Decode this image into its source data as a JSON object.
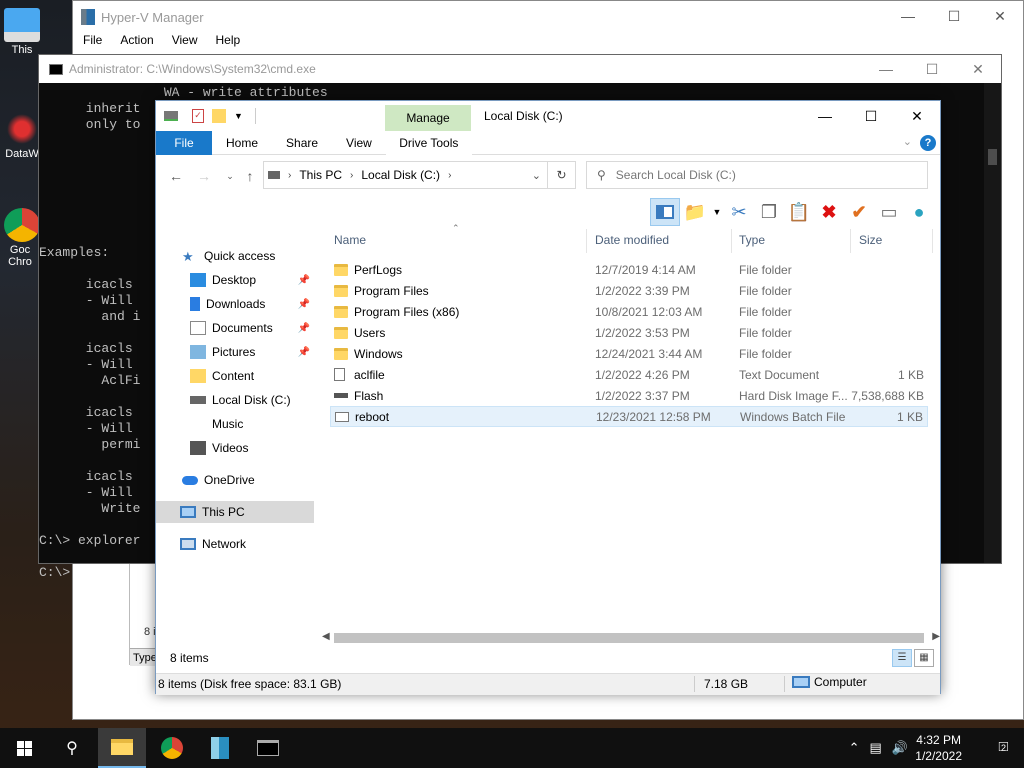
{
  "desktop": {
    "icons": [
      {
        "label": "This"
      },
      {
        "label": "DataW"
      },
      {
        "label": "Goc Chro"
      }
    ]
  },
  "hyperv": {
    "title": "Hyper-V Manager",
    "menu": [
      "File",
      "Action",
      "View",
      "Help"
    ],
    "lower_count": "8 i",
    "lower_type": "Type"
  },
  "cmd": {
    "title": "Administrator: C:\\Windows\\System32\\cmd.exe",
    "lines": [
      "                WA - write attributes",
      "      inherit",
      "      only to",
      "",
      "",
      "",
      "",
      "",
      "",
      "",
      "Examples:",
      "",
      "      icacls",
      "      - Will",
      "        and i",
      "",
      "      icacls",
      "      - Will",
      "        AclFi",
      "",
      "      icacls",
      "      - Will",
      "        permi",
      "",
      "      icacls",
      "      - Will",
      "        Write",
      "",
      "C:\\> explorer",
      "",
      "C:\\>"
    ]
  },
  "explorer": {
    "title": "Local Disk (C:)",
    "manage_tab": "Manage",
    "ribbon_tabs": [
      "File",
      "Home",
      "Share",
      "View"
    ],
    "drive_tools": "Drive Tools",
    "address": {
      "root": "This PC",
      "current": "Local Disk (C:)"
    },
    "search_placeholder": "Search Local Disk (C:)",
    "columns": {
      "name": "Name",
      "date": "Date modified",
      "type": "Type",
      "size": "Size"
    },
    "nav": {
      "quick_access": "Quick access",
      "items": [
        {
          "label": "Desktop",
          "pinned": true
        },
        {
          "label": "Downloads",
          "pinned": true
        },
        {
          "label": "Documents",
          "pinned": true
        },
        {
          "label": "Pictures",
          "pinned": true
        },
        {
          "label": "Content",
          "pinned": false
        },
        {
          "label": "Local Disk (C:)",
          "pinned": false
        },
        {
          "label": "Music",
          "pinned": false
        },
        {
          "label": "Videos",
          "pinned": false
        }
      ],
      "onedrive": "OneDrive",
      "this_pc": "This PC",
      "network": "Network"
    },
    "files": [
      {
        "name": "PerfLogs",
        "date": "12/7/2019 4:14 AM",
        "type": "File folder",
        "size": "",
        "kind": "folder"
      },
      {
        "name": "Program Files",
        "date": "1/2/2022 3:39 PM",
        "type": "File folder",
        "size": "",
        "kind": "folder"
      },
      {
        "name": "Program Files (x86)",
        "date": "10/8/2021 12:03 AM",
        "type": "File folder",
        "size": "",
        "kind": "folder"
      },
      {
        "name": "Users",
        "date": "1/2/2022 3:53 PM",
        "type": "File folder",
        "size": "",
        "kind": "folder"
      },
      {
        "name": "Windows",
        "date": "12/24/2021 3:44 AM",
        "type": "File folder",
        "size": "",
        "kind": "folder"
      },
      {
        "name": "aclfile",
        "date": "1/2/2022 4:26 PM",
        "type": "Text Document",
        "size": "1 KB",
        "kind": "txt"
      },
      {
        "name": "Flash",
        "date": "1/2/2022 3:37 PM",
        "type": "Hard Disk Image F...",
        "size": "7,538,688 KB",
        "kind": "vhd"
      },
      {
        "name": "reboot",
        "date": "12/23/2021 12:58 PM",
        "type": "Windows Batch File",
        "size": "1 KB",
        "kind": "bat",
        "selected": true
      }
    ],
    "items_count": "8 items",
    "status": {
      "left": "8 items (Disk free space: 83.1 GB)",
      "size": "7.18 GB",
      "location": "Computer"
    }
  },
  "taskbar": {
    "time": "4:32 PM",
    "date": "1/2/2022",
    "notif_count": "2"
  },
  "colors": {
    "accent": "#1979ca",
    "manage": "#cfe8c3",
    "selected_row": "#e5f1fb"
  }
}
